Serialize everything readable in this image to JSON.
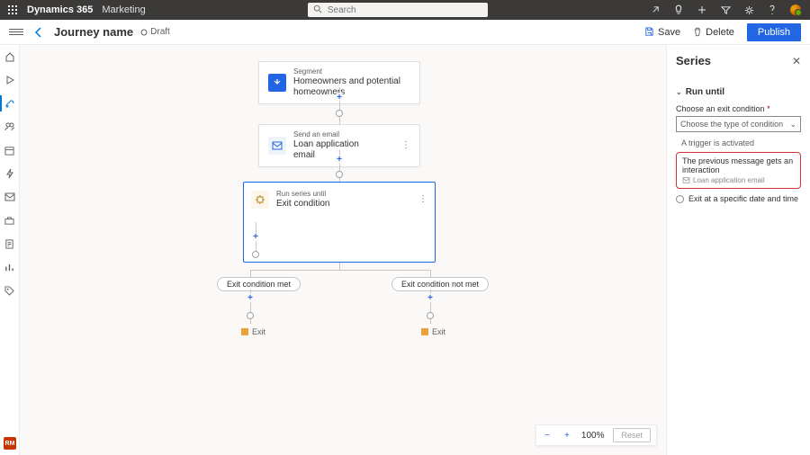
{
  "topbar": {
    "brand": "Dynamics 365",
    "module": "Marketing",
    "search_placeholder": "Search"
  },
  "cmdbar": {
    "title": "Journey name",
    "status": "Draft",
    "save": "Save",
    "delete": "Delete",
    "publish": "Publish"
  },
  "leftrail": {
    "badge": "RM"
  },
  "canvas": {
    "node1": {
      "sup": "Segment",
      "main": "Homeowners and potential homeowners"
    },
    "node2": {
      "sup": "Send an email",
      "main": "Loan application email"
    },
    "node3": {
      "sup": "Run series until",
      "main": "Exit condition"
    },
    "pill_met": "Exit condition met",
    "pill_notmet": "Exit condition not met",
    "exit": "Exit"
  },
  "zoom": {
    "percent": "100%",
    "reset": "Reset"
  },
  "rpanel": {
    "title": "Series",
    "section": "Run until",
    "field_label": "Choose an exit condition",
    "dropdown_placeholder": "Choose the type of condition",
    "opt_trigger": "A trigger is activated",
    "highlight_title": "The previous message gets an interaction",
    "highlight_sub": "Loan application email",
    "opt_exit_time": "Exit at a specific date and time"
  }
}
